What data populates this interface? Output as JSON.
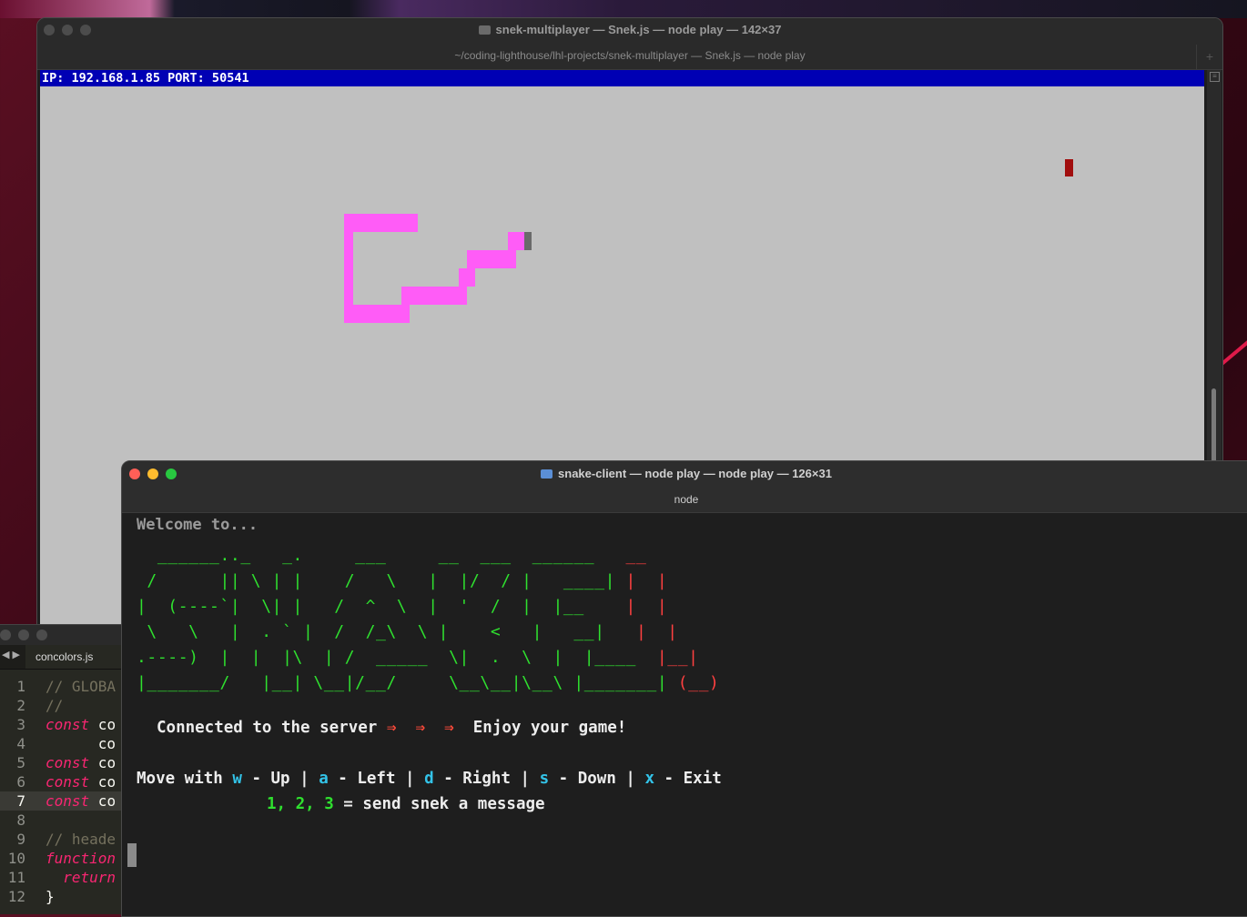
{
  "server_window": {
    "title": "snek-multiplayer — Snek.js — node play — 142×37",
    "subtitle": "~/coding-lighthouse/lhl-projects/snek-multiplayer — Snek.js — node play",
    "newtab_icon": "+",
    "status": "IP: 192.168.1.85 PORT: 50541",
    "field_color": "#c0c0c0",
    "snake_color": "#ff5cf7",
    "snake_head_color": "#6a6a6a",
    "food_color": "#a10e0e"
  },
  "editor_window": {
    "tab_label": "concolors.js",
    "lines": [
      {
        "n": "1",
        "text": "// GLOBA",
        "cls": "c-comment"
      },
      {
        "n": "2",
        "text": "//",
        "cls": "c-comment"
      },
      {
        "n": "3",
        "text": "const",
        "rest": " co",
        "cls": "c-kw"
      },
      {
        "n": "4",
        "text": "",
        "rest": "      co",
        "cls": "c-kw"
      },
      {
        "n": "5",
        "text": "const",
        "rest": " co",
        "cls": "c-kw"
      },
      {
        "n": "6",
        "text": "const",
        "rest": " co",
        "cls": "c-kw"
      },
      {
        "n": "7",
        "text": "const",
        "rest": " co",
        "cls": "c-kw",
        "active": true
      },
      {
        "n": "8",
        "text": "",
        "cls": "c-plain"
      },
      {
        "n": "9",
        "text": "// heade",
        "cls": "c-comment"
      },
      {
        "n": "10",
        "text": "function",
        "cls": "c-kw"
      },
      {
        "n": "11",
        "text": "  return",
        "cls": "c-kw"
      },
      {
        "n": "12",
        "text": "}",
        "cls": "c-plain"
      }
    ]
  },
  "client_window": {
    "title": "snake-client — node play — node play — 126×31",
    "subtitle": "node",
    "welcome": "Welcome to...",
    "connected_prefix": "Connected to the server ",
    "arrow": "⇒",
    "connected_suffix": "Enjoy your game!",
    "controls": [
      {
        "pre": "Move with ",
        "key": "w",
        "label": " - Up | "
      },
      {
        "key": "a",
        "label": " - Left | "
      },
      {
        "key": "d",
        "label": " - Right | "
      },
      {
        "key": "s",
        "label": " - Down | "
      },
      {
        "key": "x",
        "label": " - Exit"
      }
    ],
    "message_keys": "1, 2, 3",
    "message_text": " = send snek a message"
  },
  "banner": {
    "green_lines": [
      "  ______.._   _.     ___     __  ___  ______ ",
      " /      || \\ | |    /   \\   |  |/  / |   ____|",
      "|  (----`|  \\| |   /  ^  \\  |  '  /  |  |__   ",
      " \\   \\   |  . ` |  /  /_\\  \\ |    <   |   __|  ",
      ".----)  |  |  |\\  | /  _____  \\|  .  \\  |  |____ ",
      "|_______/   |__| \\__|/__/     \\__\\__|\\__\\ |_______|"
    ],
    "red_lines": [
      " __ ",
      "|  |",
      "|  |",
      "|  |",
      "|__|",
      "(__)"
    ]
  }
}
